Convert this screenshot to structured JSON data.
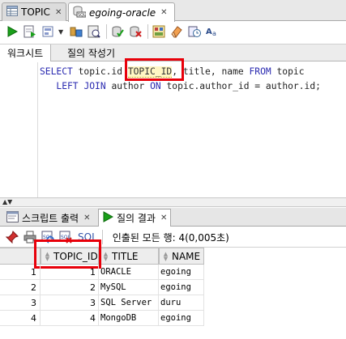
{
  "tabs": [
    {
      "label": "TOPIC",
      "icon": "table-grid-icon",
      "active": false
    },
    {
      "label": "egoing-oracle",
      "icon": "sql-worksheet-icon",
      "active": true
    }
  ],
  "subtabs": [
    {
      "label": "워크시트",
      "active": true
    },
    {
      "label": "질의 작성기",
      "active": false
    }
  ],
  "editor": {
    "line1": {
      "kw_select": "SELECT",
      "part1": " topic.id ",
      "alias": "TOPIC_ID",
      "part2": ", title, name ",
      "kw_from": "FROM",
      "part3": " topic"
    },
    "line2": {
      "indent": "   ",
      "kw_left": "LEFT",
      "sp1": " ",
      "kw_join": "JOIN",
      "part1": " author ",
      "kw_on": "ON",
      "part2": " topic.author_id = author.id;"
    }
  },
  "bottom_tabs": [
    {
      "label": "스크립트 출력",
      "active": false
    },
    {
      "label": "질의 결과",
      "active": true
    }
  ],
  "results_toolbar": {
    "sql_link": "SQL",
    "fetch_status": "인출된 모든 행: 4(0,005초)"
  },
  "grid": {
    "columns": [
      "TOPIC_ID",
      "TITLE",
      "NAME"
    ],
    "rows": [
      {
        "num": "1",
        "topic_id": "1",
        "title": "ORACLE",
        "name": "egoing"
      },
      {
        "num": "2",
        "topic_id": "2",
        "title": "MySQL",
        "name": "egoing"
      },
      {
        "num": "3",
        "topic_id": "3",
        "title": "SQL Server",
        "name": "duru"
      },
      {
        "num": "4",
        "topic_id": "4",
        "title": "MongoDB",
        "name": "egoing"
      }
    ]
  },
  "colors": {
    "highlight_box": "#e8000a",
    "keyword": "#2a2ab0",
    "run_green": "#1aa01a"
  }
}
